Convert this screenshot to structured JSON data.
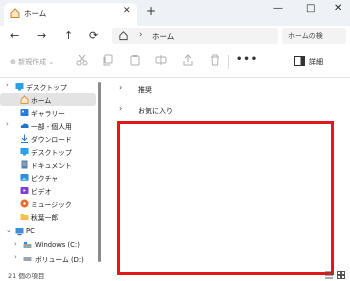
{
  "tab": {
    "title": "ホーム",
    "close": "✕"
  },
  "window_controls": {
    "new_tab": "+",
    "minimize": "—",
    "maximize": "□",
    "close": "✕"
  },
  "nav": {
    "back": "←",
    "forward": "→",
    "up": "↑",
    "refresh": "⟳"
  },
  "address": {
    "separator": "›",
    "location": "ホーム"
  },
  "search": {
    "placeholder": "ホームの検"
  },
  "commandbar": {
    "new_label": "⊕ 新規作成 ⌄",
    "more": "•••",
    "details_label": "詳細"
  },
  "sidebar": {
    "items": [
      {
        "label": "デスクトップ",
        "icon": "desktop-folder-icon",
        "expand": "›"
      },
      {
        "label": "ホーム",
        "icon": "home-icon",
        "selected": true
      },
      {
        "label": "ギャラリー",
        "icon": "gallery-icon"
      },
      {
        "label": "一部 - 個人用",
        "icon": "onedrive-cloud-icon",
        "expand": "›"
      },
      {
        "label": "ダウンロード",
        "icon": "download-icon"
      },
      {
        "label": "デスクトップ",
        "icon": "desktop-icon"
      },
      {
        "label": "ドキュメント",
        "icon": "document-icon"
      },
      {
        "label": "ピクチャ",
        "icon": "pictures-icon"
      },
      {
        "label": "ビデオ",
        "icon": "video-icon"
      },
      {
        "label": "ミュージック",
        "icon": "music-icon"
      },
      {
        "label": "秋葉一郎",
        "icon": "user-folder-icon"
      },
      {
        "label": "PC",
        "icon": "pc-icon",
        "expand": "⌄"
      },
      {
        "label": "Windows (C:)",
        "icon": "drive-icon",
        "expand": "›"
      },
      {
        "label": "ボリューム (D:)",
        "icon": "drive-icon",
        "expand": "›"
      }
    ]
  },
  "content": {
    "groups": [
      {
        "label": "推奨",
        "chevron": "›"
      },
      {
        "label": "お気に入り",
        "chevron": "›"
      }
    ]
  },
  "status": {
    "item_count": "21 個の項目"
  },
  "colors": {
    "highlight": "#e1171c",
    "folder": "#f2c14e",
    "selected": "#e3e3e3",
    "accent": "#0067c0"
  }
}
